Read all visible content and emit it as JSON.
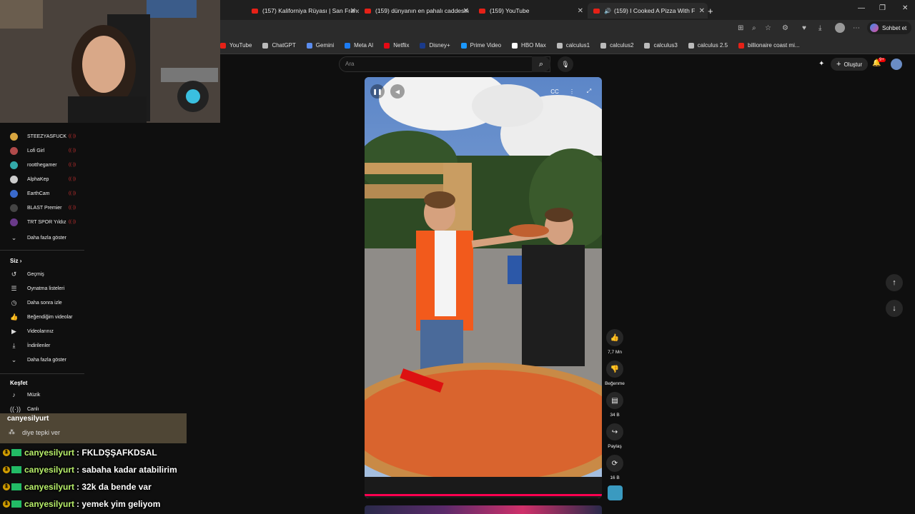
{
  "browser": {
    "tabs": [
      {
        "label": "(157) Kaliforniya Rüyası | San Franc",
        "active": false
      },
      {
        "label": "(159) dünyanın en pahalı caddesin",
        "active": false
      },
      {
        "label": "(159) YouTube",
        "active": false
      },
      {
        "label": "(159) I Cooked A Pizza With F",
        "active": true
      }
    ],
    "new_tab": "+",
    "copilot_label": "Sohbet et",
    "bookmarks": [
      {
        "label": "YouTube",
        "color": "#e62117"
      },
      {
        "label": "ChatGPT",
        "color": "#bbbbbb"
      },
      {
        "label": "Gemini",
        "color": "#5b8def"
      },
      {
        "label": "Meta AI",
        "color": "#1c7cf4"
      },
      {
        "label": "Netflix",
        "color": "#e50914"
      },
      {
        "label": "Disney+",
        "color": "#1a3a8a"
      },
      {
        "label": "Prime Video",
        "color": "#1a98ff"
      },
      {
        "label": "HBO Max",
        "color": "#ffffff"
      },
      {
        "label": "calculus1",
        "color": "#bbbbbb"
      },
      {
        "label": "calculus2",
        "color": "#bbbbbb"
      },
      {
        "label": "calculus3",
        "color": "#bbbbbb"
      },
      {
        "label": "calculus 2.5",
        "color": "#bbbbbb"
      },
      {
        "label": "billionaire coast mi...",
        "color": "#e62117"
      }
    ]
  },
  "youtube": {
    "search_placeholder": "Ara",
    "create_label": "Oluştur",
    "notif_count": "9+",
    "subscriptions": [
      {
        "name": "STEEZYASFUCK",
        "color": "#d8a640"
      },
      {
        "name": "Lofi Girl",
        "color": "#b04a4a"
      },
      {
        "name": "rootthegamer",
        "color": "#3aa"
      },
      {
        "name": "AlphaKep",
        "color": "#ccc"
      },
      {
        "name": "EarthCam",
        "color": "#3a6acc"
      },
      {
        "name": "BLAST Premier",
        "color": "#444"
      },
      {
        "name": "TRT SPOR Yıldız",
        "color": "#6a3a8a"
      }
    ],
    "show_more": "Daha fazla göster",
    "you_section": "Siz",
    "you_items": [
      {
        "label": "Geçmiş",
        "icon": "history-icon",
        "glyph": "↺"
      },
      {
        "label": "Oynatma listeleri",
        "icon": "playlist-icon",
        "glyph": "☰"
      },
      {
        "label": "Daha sonra izle",
        "icon": "clock-icon",
        "glyph": "◷"
      },
      {
        "label": "Beğendiğim videolar",
        "icon": "like-icon",
        "glyph": "👍"
      },
      {
        "label": "Videolarınız",
        "icon": "video-icon",
        "glyph": "▶"
      },
      {
        "label": "İndirilenler",
        "icon": "download-icon",
        "glyph": "⤓"
      },
      {
        "label": "Daha fazla göster",
        "icon": "chevron-down-icon",
        "glyph": "⌄"
      }
    ],
    "explore_section": "Keşfet",
    "explore_items": [
      {
        "label": "Müzik",
        "icon": "music-icon",
        "glyph": "♪"
      },
      {
        "label": "Canlı",
        "icon": "live-icon",
        "glyph": "((·))"
      }
    ],
    "actions": {
      "likes": "7,7 Mn",
      "dislike": "Beğenme",
      "comments": "34 B",
      "share": "Paylaş",
      "remix": "16 B"
    }
  },
  "chat": {
    "overlay_user": "canyesilyurt",
    "overlay_hint": "diye tepki ver",
    "messages": [
      {
        "user": "canyesilyurt",
        "text": ": FKLDŞŞAFKDSAL"
      },
      {
        "user": "canyesilyurt",
        "text": ": sabaha kadar atabilirim"
      },
      {
        "user": "canyesilyurt",
        "text": ": 32k da bende var"
      },
      {
        "user": "canyesilyurt",
        "text": ": yemek yim geliyom"
      }
    ]
  }
}
